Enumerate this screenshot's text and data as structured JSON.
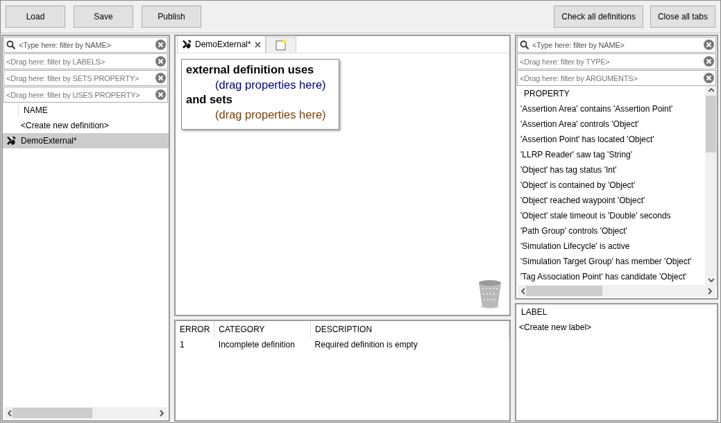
{
  "toolbar": {
    "left_buttons": [
      "Load",
      "Save",
      "Publish"
    ],
    "right_buttons": [
      "Check all definitions",
      "Close all tabs"
    ]
  },
  "definitions_panel": {
    "filters": [
      {
        "kind": "search",
        "placeholder": "<Type here: filter by NAME>"
      },
      {
        "kind": "drag",
        "placeholder": "<Drag here: filter by LABELS>"
      },
      {
        "kind": "drag",
        "placeholder": "<Drag here: filter by SETS PROPERTY>"
      },
      {
        "kind": "drag",
        "placeholder": "<Drag here: filter by USES PROPERTY>"
      }
    ],
    "column": "NAME",
    "items": [
      {
        "kind": "create",
        "label": "<Create new definition>",
        "selected": false
      },
      {
        "kind": "definition",
        "label": "DemoExternal*",
        "selected": true
      }
    ]
  },
  "editor": {
    "tabs": [
      {
        "kind": "definition",
        "label": "DemoExternal*",
        "selected": true
      },
      {
        "kind": "new",
        "selected": false
      }
    ],
    "block": [
      {
        "kind": "keyword",
        "text": "external definition uses"
      },
      {
        "kind": "slot",
        "text": "(drag properties here)",
        "color": "#000080"
      },
      {
        "kind": "keyword",
        "text": "and sets"
      },
      {
        "kind": "slot",
        "text": "(drag properties here)",
        "color": "#804000"
      }
    ]
  },
  "errors": {
    "columns": [
      "ERROR",
      "CATEGORY",
      "DESCRIPTION"
    ],
    "rows": [
      [
        "1",
        "Incomplete definition",
        "Required definition is empty"
      ]
    ]
  },
  "properties_panel": {
    "filters": [
      {
        "kind": "search",
        "placeholder": "<Type here: filter by NAME>"
      },
      {
        "kind": "drag",
        "placeholder": "<Drag here: filter by TYPE>"
      },
      {
        "kind": "drag",
        "placeholder": "<Drag here: filter by ARGUMENTS>"
      }
    ],
    "column": "PROPERTY",
    "items": [
      "'Assertion Area' contains 'Assertion Point'",
      "'Assertion Area' controls 'Object'",
      "'Assertion Point' has located 'Object'",
      "'LLRP Reader' saw tag 'String'",
      "'Object' has tag status 'Int'",
      "'Object' is contained by 'Object'",
      "'Object' reached waypoint 'Object'",
      "'Object' stale timeout is 'Double' seconds",
      "'Path Group' controls 'Object'",
      "'Simulation Lifecycle' is active",
      "'Simulation Target Group' has member 'Object'",
      "'Tag Association Point' has candidate 'Object'"
    ]
  },
  "labels_panel": {
    "column": "LABEL",
    "items": [
      "<Create new label>"
    ]
  }
}
